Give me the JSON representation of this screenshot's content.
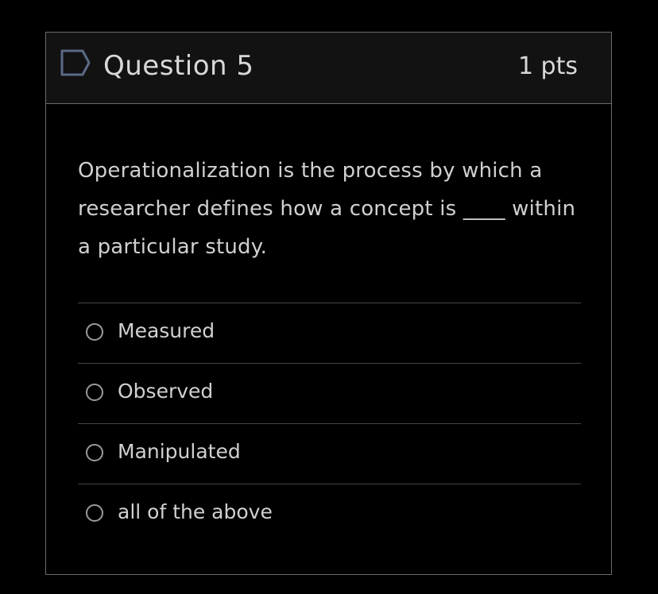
{
  "question": {
    "title": "Question 5",
    "points": "1 pts",
    "flag_icon": "flag-icon",
    "text": "Operationalization is the process by which a researcher defines how a concept is ____ within a particular study."
  },
  "answers": [
    {
      "label": "Measured",
      "selected": false
    },
    {
      "label": "Observed",
      "selected": false
    },
    {
      "label": "Manipulated",
      "selected": false
    },
    {
      "label": "all of the above",
      "selected": false
    }
  ],
  "colors": {
    "background": "#000000",
    "header_background": "#121212",
    "border": "#6b6b6b",
    "text": "#d0d0d0",
    "flag": "#5a6a85"
  }
}
